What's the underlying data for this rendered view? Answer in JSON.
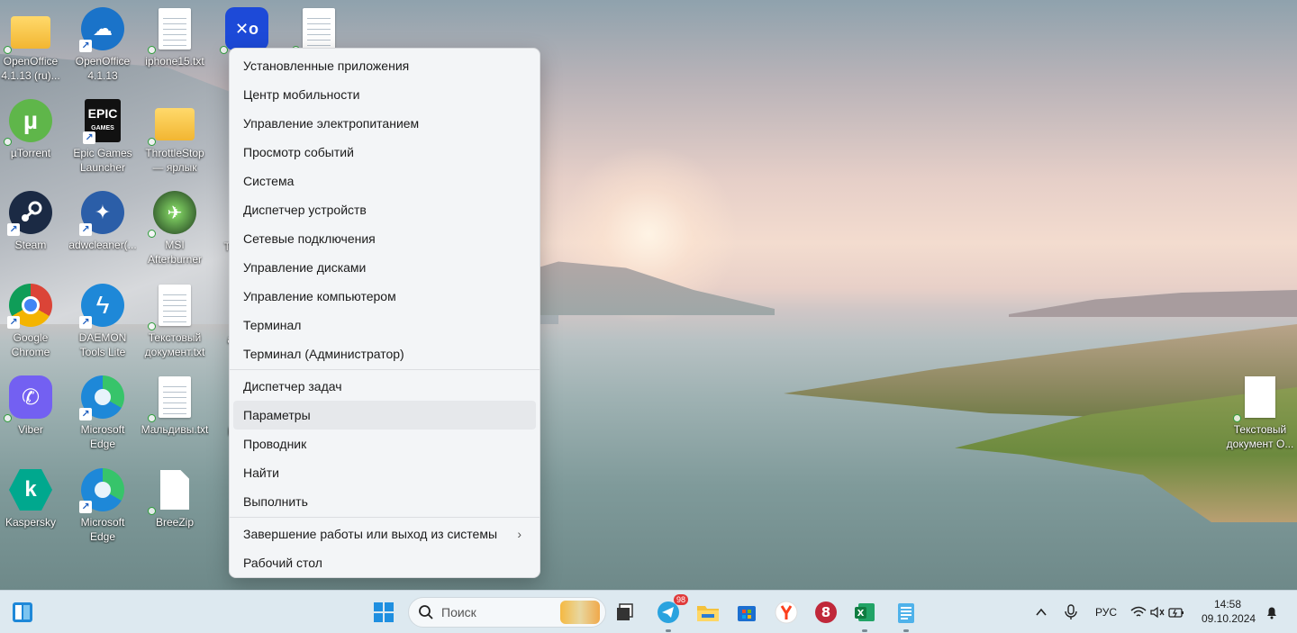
{
  "desktop": {
    "icons": [
      {
        "id": "openoffice-ru",
        "label": "OpenOffice 4.1.13 (ru)..."
      },
      {
        "id": "openoffice",
        "label": "OpenOffice 4.1.13"
      },
      {
        "id": "iphone15",
        "label": "iphone15.txt"
      },
      {
        "id": "xo-app",
        "label": ""
      },
      {
        "id": "doc-top",
        "label": ""
      },
      {
        "id": "utorrent",
        "label": "µTorrent"
      },
      {
        "id": "epic",
        "label": "Epic Games Launcher"
      },
      {
        "id": "throttlestop",
        "label": "ThrottleStop — ярлык"
      },
      {
        "id": "steam",
        "label": "Steam"
      },
      {
        "id": "adwcleaner",
        "label": "adwcleaner(..."
      },
      {
        "id": "msi",
        "label": "MSI Afterburner"
      },
      {
        "id": "chrome",
        "label": "Google Chrome"
      },
      {
        "id": "daemon",
        "label": "DAEMON Tools Lite"
      },
      {
        "id": "textdoc",
        "label": "Текстовый документ.txt"
      },
      {
        "id": "viber",
        "label": "Viber"
      },
      {
        "id": "edge1",
        "label": "Microsoft Edge"
      },
      {
        "id": "maldives",
        "label": "Мальдивы.txt"
      },
      {
        "id": "kaspersky",
        "label": "Kaspersky"
      },
      {
        "id": "edge2",
        "label": "Microsoft Edge"
      },
      {
        "id": "breezip",
        "label": "BreeZip"
      },
      {
        "id": "textdoc-right",
        "label": "Текстовый документ О..."
      }
    ],
    "partial_labels": {
      "col4_row3": "Т А",
      "col4_row4": "adv",
      "col4_row5": "Ко",
      "col4_row2": "Е"
    }
  },
  "context_menu": {
    "items": [
      "Установленные приложения",
      "Центр мобильности",
      "Управление электропитанием",
      "Просмотр событий",
      "Система",
      "Диспетчер устройств",
      "Сетевые подключения",
      "Управление дисками",
      "Управление компьютером",
      "Терминал",
      "Терминал (Администратор)",
      "Диспетчер задач",
      "Параметры",
      "Проводник",
      "Найти",
      "Выполнить",
      "Завершение работы или выход из системы",
      "Рабочий стол"
    ],
    "hovered": "Параметры",
    "submenu_chevron": "›"
  },
  "taskbar": {
    "search_placeholder": "Поиск",
    "telegram_badge": "98",
    "language": "РУС",
    "time": "14:58",
    "date": "09.10.2024",
    "icons": [
      "widgets-icon",
      "start-icon",
      "search-icon",
      "task-view-icon",
      "telegram-icon",
      "file-explorer-icon",
      "microsoft-store-icon",
      "yandex-browser-icon",
      "app-red-icon",
      "excel-icon",
      "notepad-icon"
    ],
    "tray": [
      "chevron-up-icon",
      "microphone-icon",
      "wifi-icon",
      "volume-muted-icon",
      "battery-icon",
      "notification-bell-icon"
    ]
  },
  "colors": {
    "taskbar_bg": "#dde9f0",
    "menu_bg": "#f3f5f7",
    "menu_hover": "#e6e8eb",
    "windows_blue": "#0078d4"
  }
}
